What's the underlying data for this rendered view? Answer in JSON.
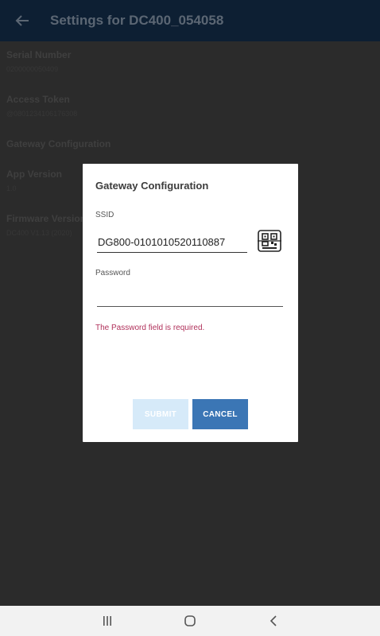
{
  "appbar": {
    "title": "Settings for DC400_054058",
    "back_icon": "arrow-left-icon"
  },
  "settings": {
    "items": [
      {
        "label": "Serial Number",
        "value": "0200000050409"
      },
      {
        "label": "Access Token",
        "value": "@0801234106176308"
      },
      {
        "label": "Gateway Configuration",
        "value": ""
      },
      {
        "label": "App Version",
        "value": "1.0"
      },
      {
        "label": "Firmware Version",
        "value": "DC400 V1.13 (2020)"
      }
    ]
  },
  "dialog": {
    "title": "Gateway Configuration",
    "ssid_label": "SSID",
    "ssid_value": "DG800-0101010520110887",
    "scan_icon": "qr-scan-icon",
    "password_label": "Password",
    "password_value": "",
    "error": "The Password field is required.",
    "submit_label": "SUBMIT",
    "cancel_label": "CANCEL"
  },
  "navbar": {
    "recents_icon": "recents-icon",
    "home_icon": "home-icon",
    "back_icon": "back-chevron-icon"
  },
  "colors": {
    "appbar": "#0d1f33",
    "overlay": "#2b2b2b",
    "submit_disabled": "#d6eaf9",
    "cancel": "#3b76b5",
    "error": "#b0305a"
  }
}
